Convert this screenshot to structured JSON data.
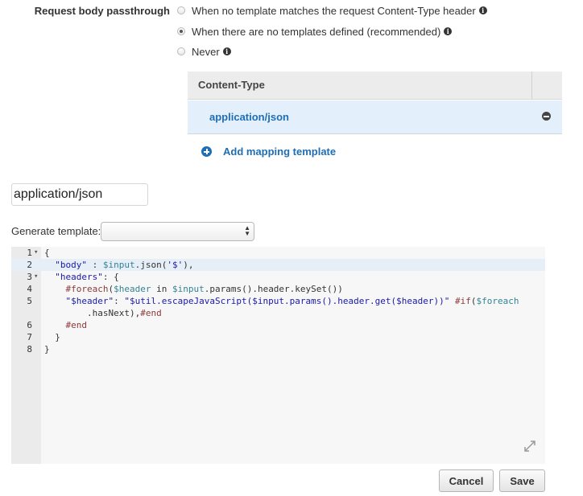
{
  "passthrough": {
    "label": "Request body passthrough",
    "options": [
      {
        "label": "When no template matches the request Content-Type header",
        "checked": false,
        "has_info": true
      },
      {
        "label": "When there are no templates defined (recommended)",
        "checked": true,
        "has_info": true
      },
      {
        "label": "Never",
        "checked": false,
        "has_info": true
      }
    ]
  },
  "content_type_table": {
    "header": "Content-Type",
    "rows": [
      "application/json"
    ],
    "add_label": "Add mapping template"
  },
  "template": {
    "content_type_value": "application/json",
    "generate_label": "Generate template:",
    "generate_selected": ""
  },
  "editor": {
    "lines": [
      {
        "num": "1",
        "fold": true,
        "text": "{"
      },
      {
        "num": "2",
        "fold": false,
        "text": "  \"body\" : $input.json('$'),"
      },
      {
        "num": "3",
        "fold": true,
        "text": "  \"headers\": {"
      },
      {
        "num": "4",
        "fold": false,
        "text": "    #foreach($header in $input.params().header.keySet())"
      },
      {
        "num": "5",
        "fold": false,
        "text": "    \"$header\": \"$util.escapeJavaScript($input.params().header.get($header))\" #if($foreach"
      },
      {
        "num": "",
        "fold": false,
        "text": "        .hasNext),#end"
      },
      {
        "num": "6",
        "fold": false,
        "text": "    #end"
      },
      {
        "num": "7",
        "fold": false,
        "text": "  }"
      },
      {
        "num": "8",
        "fold": false,
        "text": "}"
      }
    ],
    "active_line": 1
  },
  "actions": {
    "cancel_label": "Cancel",
    "save_label": "Save"
  },
  "colors": {
    "link": "#1f6eb5",
    "selected_row": "#e3f0fb",
    "header_bg": "#ececec"
  }
}
